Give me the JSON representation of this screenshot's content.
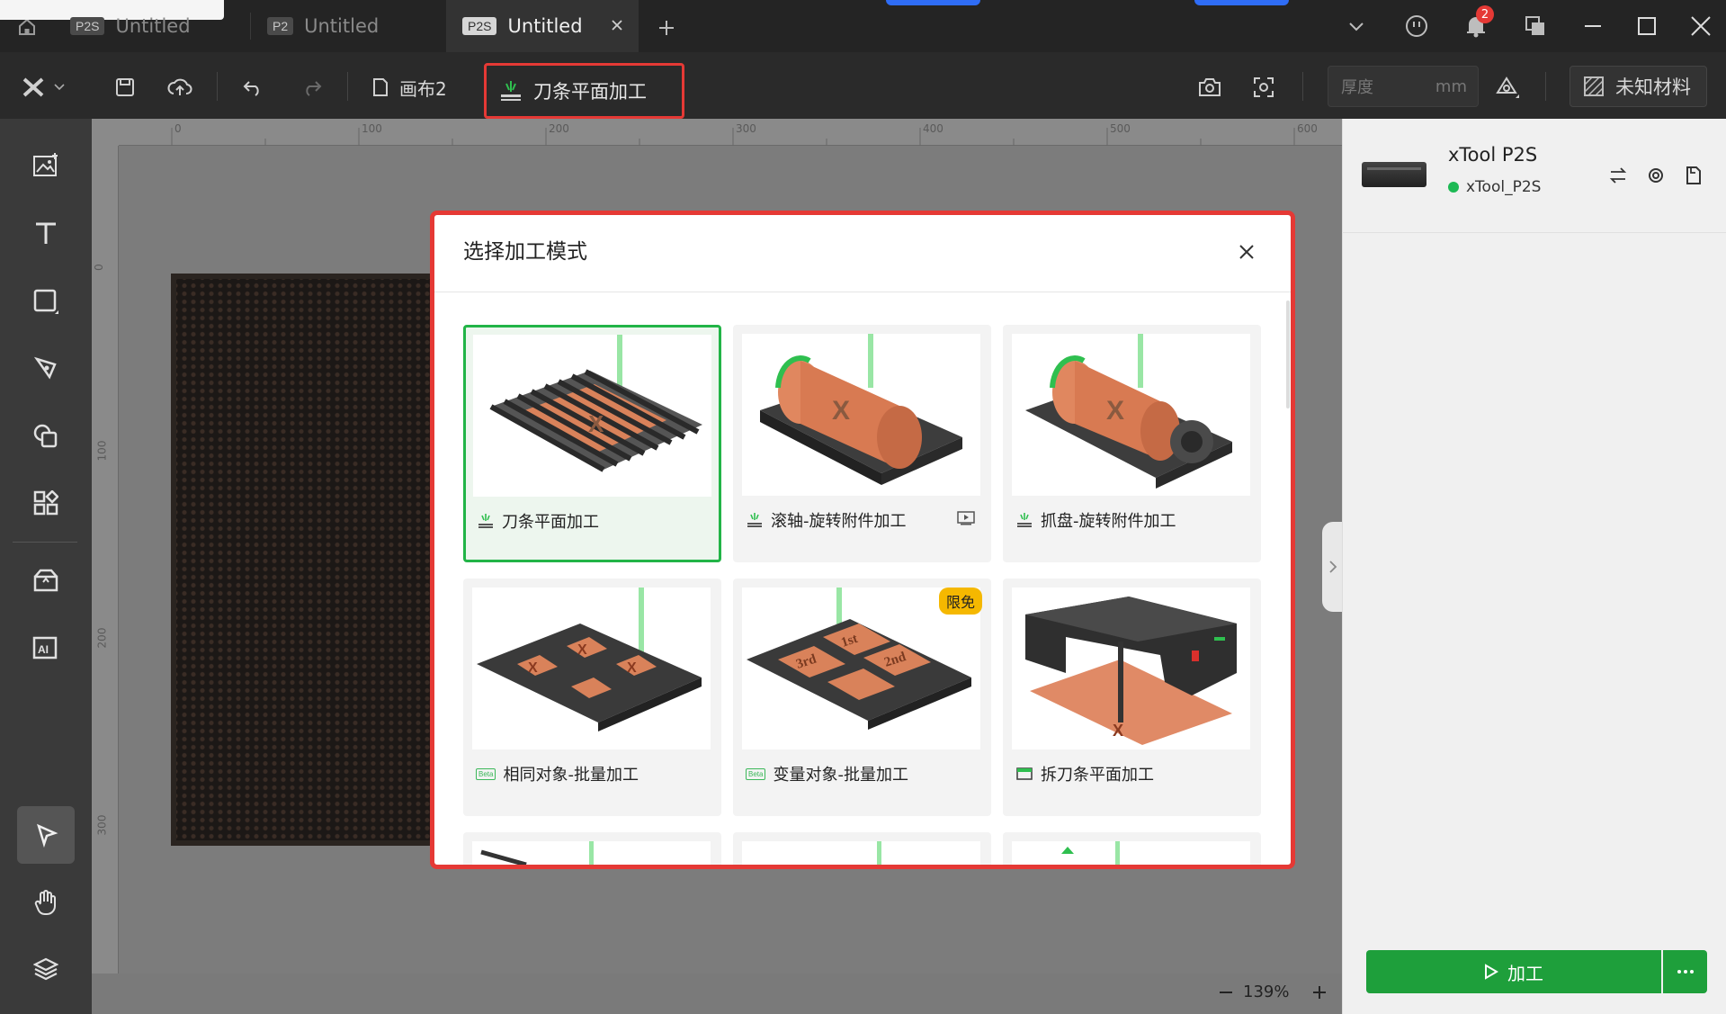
{
  "tabs": [
    {
      "badge": "P2S",
      "label": "Untitled"
    },
    {
      "badge": "P2",
      "label": "Untitled"
    },
    {
      "badge": "P2S",
      "label": "Untitled"
    }
  ],
  "notifications": {
    "count": "2"
  },
  "toolbar": {
    "canvas_name": "画布2",
    "mode_label": "刀条平面加工",
    "thickness_placeholder": "厚度",
    "thickness_unit": "mm",
    "material_label": "未知材料"
  },
  "rulers": {
    "top": [
      "0",
      "100",
      "200",
      "300",
      "400",
      "500",
      "600"
    ],
    "left": [
      "0",
      "100",
      "200",
      "300"
    ]
  },
  "device": {
    "name": "xTool P2S",
    "connection": "xTool_P2S",
    "status_color": "#1db954"
  },
  "zoom": {
    "value": "139%"
  },
  "process_button": {
    "label": "加工"
  },
  "modal": {
    "title": "选择加工模式",
    "modes": [
      {
        "label": "刀条平面加工",
        "icon": "laser-flat-icon",
        "selected": true
      },
      {
        "label": "滚轴-旋转附件加工",
        "icon": "laser-flat-icon",
        "extra_icon": "video-icon"
      },
      {
        "label": "抓盘-旋转附件加工",
        "icon": "laser-flat-icon"
      },
      {
        "label": "相同对象-批量加工",
        "icon": "beta-icon",
        "beta_text": "Beta"
      },
      {
        "label": "变量对象-批量加工",
        "icon": "beta-icon",
        "beta_text": "Beta",
        "badge": "限免"
      },
      {
        "label": "拆刀条平面加工",
        "icon": "machine-icon"
      }
    ],
    "card_text": {
      "x_mark": "X",
      "tag_1st": "1st",
      "tag_2nd": "2nd",
      "tag_3rd": "3rd"
    }
  },
  "colors": {
    "accent_green": "#1e9f3b",
    "highlight_red": "#e53935",
    "free_badge": "#f5b800"
  }
}
